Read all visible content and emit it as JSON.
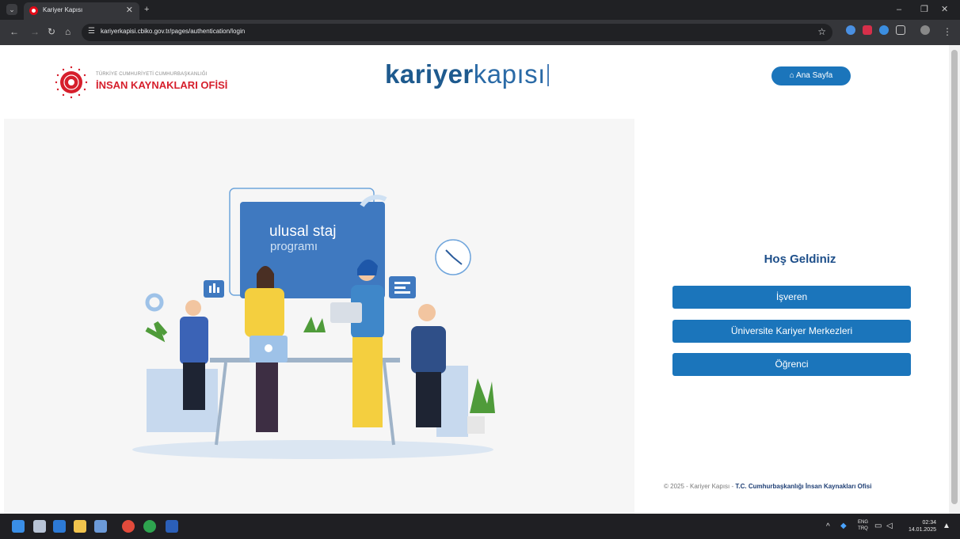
{
  "browser": {
    "tab_title": "Kariyer Kapısı",
    "url": "kariyerkapisi.cbiko.gov.tr/pages/authentication/login",
    "new_tab": "+",
    "close_tab": "✕",
    "minimize": "–",
    "restore": "❐",
    "close_window": "✕"
  },
  "header": {
    "org_small": "TÜRKİYE CUMHURİYETİ CUMHURBAŞKANLIĞI",
    "org_big": "İNSAN KAYNAKLARI OFİSİ",
    "brand_bold": "kariyer",
    "brand_thin": "kapısı",
    "home_button": "⌂ Ana Sayfa"
  },
  "hero": {
    "board_line1": "ulusal staj",
    "board_line2": "programı"
  },
  "login": {
    "welcome": "Hoş Geldiniz",
    "buttons": [
      "İşveren",
      "Üniversite Kariyer Merkezleri",
      "Öğrenci"
    ]
  },
  "footer": {
    "copy_prefix": "© 2025 - Kariyer Kapısı - ",
    "copy_org": "T.C. Cumhurbaşkanlığı İnsan Kaynakları Ofisi"
  },
  "taskbar": {
    "lang_top": "ENG",
    "lang_bottom": "TRQ",
    "time": "02:34",
    "date": "14.01.2025"
  },
  "colors": {
    "primary": "#1b75bb",
    "brand": "#1e5a8e",
    "ik_red": "#d61f2c"
  }
}
